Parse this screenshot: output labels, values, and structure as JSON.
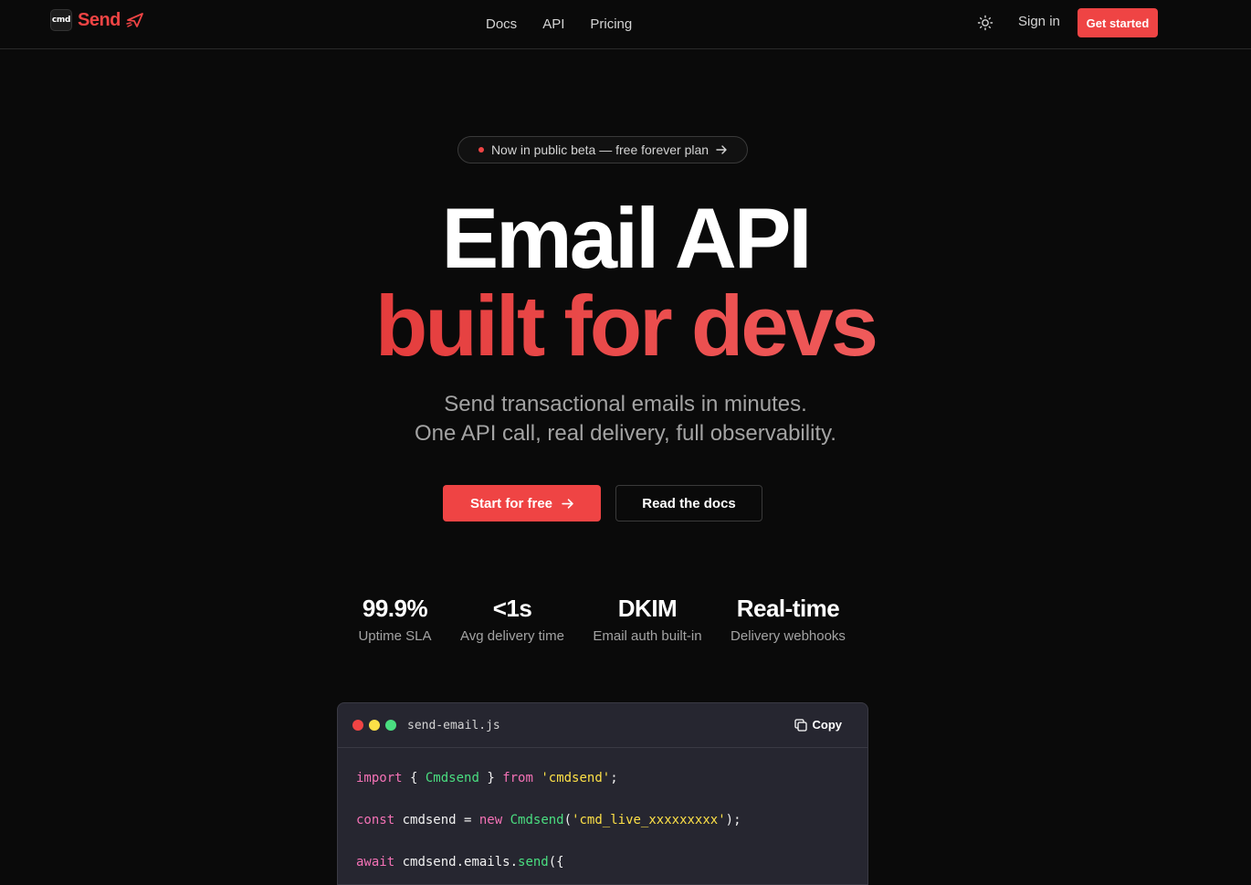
{
  "nav": {
    "logo_badge": "cmd",
    "logo_word": "Send",
    "links": [
      "Docs",
      "API",
      "Pricing"
    ],
    "sign_in": "Sign in",
    "get_started": "Get started"
  },
  "hero": {
    "pill": "Now in public beta — free forever plan",
    "title_line1": "Email API",
    "title_line2": "built for devs",
    "subtitle_line1": "Send transactional emails in minutes.",
    "subtitle_line2": "One API call, real delivery, full observability.",
    "cta_primary": "Start for free",
    "cta_secondary": "Read the docs"
  },
  "stats": [
    {
      "value": "99.9%",
      "label": "Uptime SLA"
    },
    {
      "value": "<1s",
      "label": "Avg delivery time"
    },
    {
      "value": "DKIM",
      "label": "Email auth built-in"
    },
    {
      "value": "Real-time",
      "label": "Delivery webhooks"
    }
  ],
  "code": {
    "filename": "send-email.js",
    "copy_label": "Copy",
    "line1": {
      "kw1": "import",
      "p1": " { ",
      "cls": "Cmdsend",
      "p2": " } ",
      "kw2": "from",
      "p3": " ",
      "str": "'cmdsend'",
      "p4": ";"
    },
    "line2": {
      "kw1": "const",
      "p1": " cmdsend = ",
      "kw2": "new",
      "p2": " ",
      "cls": "Cmdsend",
      "p3": "(",
      "str": "'cmd_live_xxxxxxxxx'",
      "p4": ");"
    },
    "line3": {
      "kw1": "await",
      "p1": " cmdsend.emails.",
      "fn": "send",
      "p2": "({"
    }
  },
  "colors": {
    "accent": "#ef4444",
    "background": "#0a0a0a",
    "code_bg": "#262630"
  }
}
